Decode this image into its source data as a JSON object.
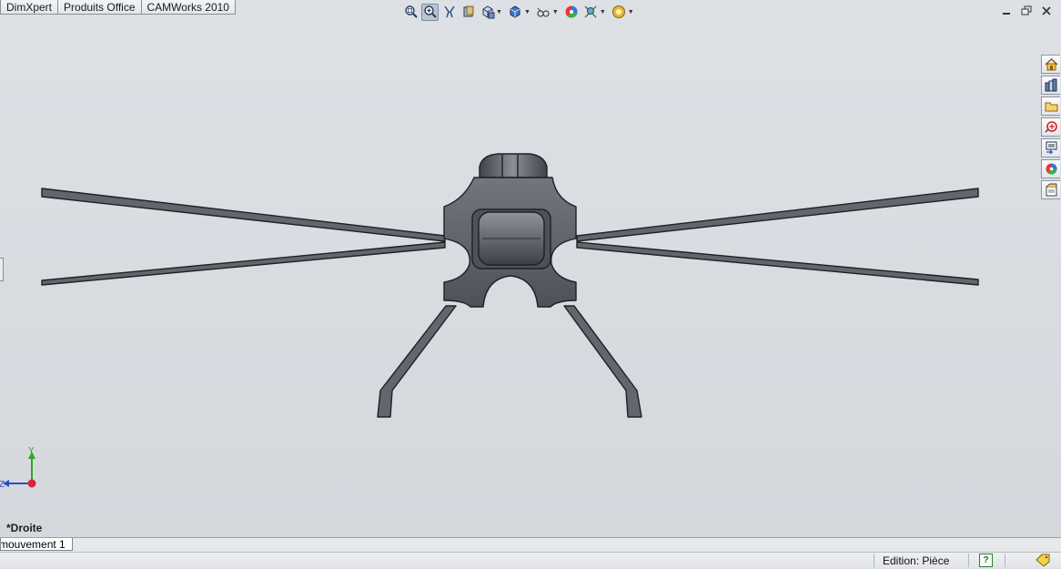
{
  "command_tabs": [
    "DimXpert",
    "Produits Office",
    "CAMWorks 2010"
  ],
  "heads_up_toolbar": {
    "buttons": [
      "zoom-to-fit-icon",
      "zoom-to-area-icon",
      "previous-view-icon",
      "section-view-icon",
      "view-orientation-icon",
      "display-style-icon",
      "hide-show-items-icon",
      "edit-appearance-icon",
      "apply-scene-icon",
      "view-settings-icon"
    ]
  },
  "task_pane": {
    "buttons": [
      "solidworks-resources-icon",
      "design-library-icon",
      "file-explorer-icon",
      "search-icon",
      "view-palette-icon",
      "appearances-scenes-icon",
      "custom-properties-icon"
    ]
  },
  "viewport": {
    "view_name": "*Droite",
    "triad_labels": {
      "y": "Y",
      "z": "Z"
    },
    "colors": {
      "background": "#d8dbe0",
      "model_fill": "#5e6269",
      "model_edge": "#1e2024"
    }
  },
  "bottom_tabs": [
    "mouvement 1"
  ],
  "status_bar": {
    "mode": "Edition: Pièce",
    "help": "?"
  }
}
